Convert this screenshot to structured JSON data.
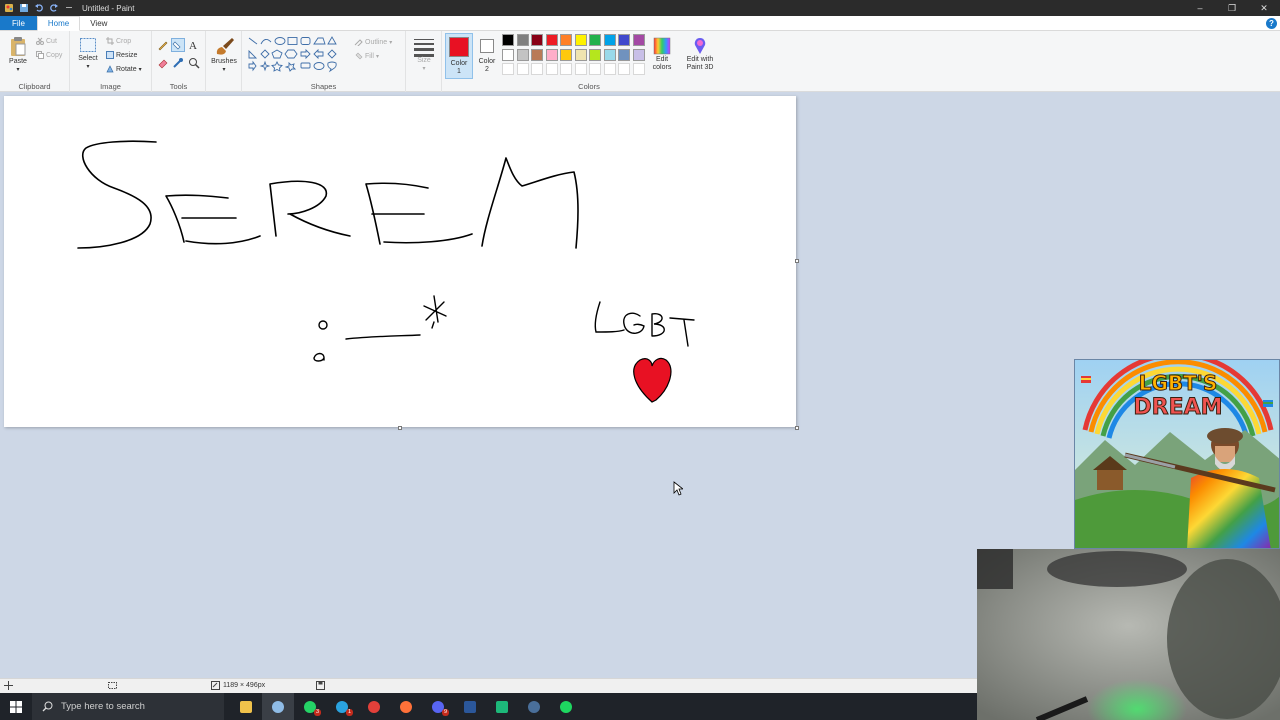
{
  "window": {
    "title": "Untitled - Paint",
    "controls": {
      "minimize": "–",
      "restore": "❐",
      "close": "✕"
    }
  },
  "quick_access": [
    "paint-app-icon",
    "save-icon",
    "undo-icon",
    "redo-icon",
    "customize-icon"
  ],
  "tabs": [
    {
      "label": "File"
    },
    {
      "label": "Home"
    },
    {
      "label": "View"
    }
  ],
  "help": "?",
  "ribbon": {
    "clipboard": {
      "label": "Clipboard",
      "paste": "Paste",
      "cut": "Cut",
      "copy": "Copy"
    },
    "image": {
      "label": "Image",
      "select": "Select",
      "crop": "Crop",
      "resize": "Resize",
      "rotate": "Rotate"
    },
    "tools": {
      "label": "Tools"
    },
    "brushes": {
      "label": "Brushes"
    },
    "shapes": {
      "label": "Shapes",
      "outline": "Outline",
      "fill": "Fill"
    },
    "size": {
      "label": "Size"
    },
    "color1": {
      "label": "Color",
      "num": "1",
      "value": "#e81123"
    },
    "color2": {
      "label": "Color",
      "num": "2",
      "value": "#ffffff"
    },
    "colors": {
      "label": "Colors",
      "row1": [
        "#000000",
        "#7f7f7f",
        "#880015",
        "#ed1c24",
        "#ff7f27",
        "#fff200",
        "#22b14c",
        "#00a2e8",
        "#3f48cc",
        "#a349a4"
      ],
      "row2": [
        "#ffffff",
        "#c3c3c3",
        "#b97a57",
        "#ffaec9",
        "#ffc90e",
        "#efe4b0",
        "#b5e61d",
        "#99d9ea",
        "#7092be",
        "#c8bfe7"
      ],
      "empty_count": 10
    },
    "edit_colors": {
      "line1": "Edit",
      "line2": "colors"
    },
    "paint3d": {
      "line1": "Edit with",
      "line2": "Paint 3D"
    }
  },
  "statusbar": {
    "canvas_size": "1189 × 496px"
  },
  "taskbar": {
    "search_placeholder": "Type here to search",
    "apps": [
      {
        "name": "file-explorer",
        "color": "#f0c24b"
      },
      {
        "name": "paint",
        "color": "#8fbce6"
      },
      {
        "name": "whatsapp",
        "color": "#25d366",
        "badge": "3"
      },
      {
        "name": "telegram",
        "color": "#2aa3e0",
        "badge": "1"
      },
      {
        "name": "chrome",
        "color": "#e3403a"
      },
      {
        "name": "firefox",
        "color": "#ff7139"
      },
      {
        "name": "discord",
        "color": "#5865f2",
        "badge": "9"
      },
      {
        "name": "word",
        "color": "#2b579a"
      },
      {
        "name": "app-green",
        "color": "#1db97a"
      },
      {
        "name": "steam",
        "color": "#4a6f9a"
      },
      {
        "name": "spotify",
        "color": "#1ed760"
      }
    ]
  },
  "overlay": {
    "thumbnail_title_line1": "LGBT'S",
    "thumbnail_title_line2": "DREAM"
  }
}
